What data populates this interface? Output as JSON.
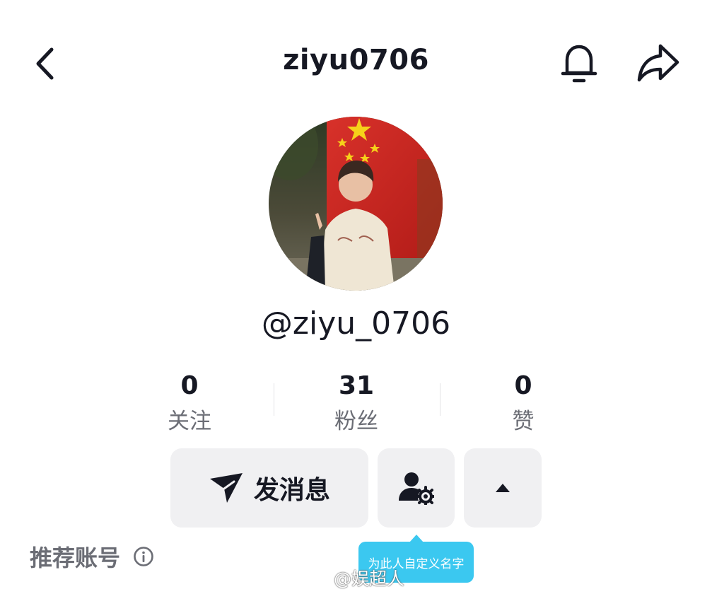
{
  "header": {
    "title": "ziyu0706",
    "back_icon": "chevron-left-icon",
    "bell_icon": "bell-icon",
    "share_icon": "share-icon"
  },
  "profile": {
    "avatar": "avatar-photo",
    "handle": "@ziyu_0706"
  },
  "stats": [
    {
      "value": "0",
      "label": "关注"
    },
    {
      "value": "31",
      "label": "粉丝"
    },
    {
      "value": "0",
      "label": "赞"
    }
  ],
  "actions": {
    "message_label": "发消息",
    "message_icon": "send-icon",
    "user_settings_icon": "user-settings-icon",
    "expand_icon": "triangle-up-icon"
  },
  "tooltip": {
    "text": "为此人自定义名字",
    "color": "#3bc8f0"
  },
  "recommended": {
    "label": "推荐账号",
    "info_icon": "info-icon"
  },
  "watermark": {
    "text": "@娱超人"
  },
  "colors": {
    "text_primary": "#161823",
    "text_secondary": "#6b6d75",
    "button_bg": "#f0f0f2",
    "tooltip": "#3bc8f0"
  }
}
